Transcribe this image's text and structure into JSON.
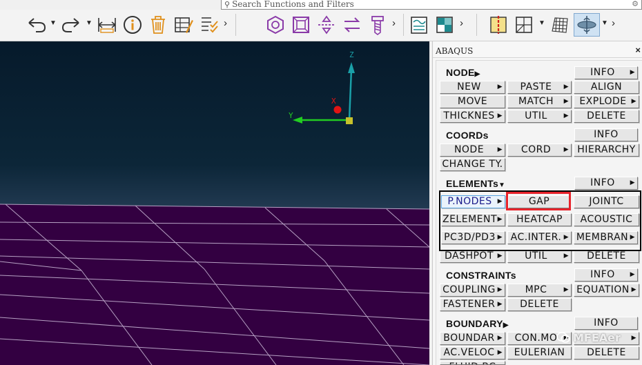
{
  "search": {
    "placeholder": "Search Functions and Filters"
  },
  "toolbar": {
    "icons": [
      "undo-icon",
      "redo-icon",
      "measure-icon",
      "info-icon",
      "delete-icon",
      "edit-property-icon",
      "checklist-icon",
      "hexagon-icon",
      "frame-icon",
      "mirror-icon",
      "swap-icon",
      "screw-icon",
      "chart-icon",
      "shading-icon",
      "section-cut-icon",
      "mesh-grid-icon",
      "wire-mesh-icon",
      "view-orient-icon"
    ]
  },
  "viewport": {
    "axis_labels": {
      "z": "Z",
      "y": "Y",
      "x": "X"
    },
    "colors": {
      "ground": "#330041",
      "grid_lines": "#b7a2c4",
      "y_axis": "#22cc22",
      "z_axis": "#1aa0a8",
      "x_marker": "#e01414",
      "origin": "#c7c12b"
    }
  },
  "panel": {
    "title": "ABAQUS",
    "close": "×",
    "sections": {
      "node": {
        "label": "NODE",
        "buttons": {
          "info": "INFO",
          "new": "NEW",
          "paste": "PASTE",
          "align": "ALIGN",
          "move": "MOVE",
          "match": "MATCH",
          "explode": "EXPLODE",
          "thickness": "THICKNES",
          "util": "UTIL",
          "delete": "DELETE"
        }
      },
      "coords": {
        "label": "COORDs",
        "buttons": {
          "info": "INFO",
          "node": "NODE",
          "cord": "CORD",
          "hierarchy": "HIERARCHY",
          "change_type": "CHANGE TY."
        }
      },
      "elements": {
        "label": "ELEMENTs",
        "buttons": {
          "info": "INFO",
          "pnodes": "P.NODES",
          "gap": "GAP",
          "jointc": "JOINTC",
          "zelement": "ZELEMENT",
          "heatcap": "HEATCAP",
          "acoustic": "ACOUSTIC",
          "pc3d": "PC3D/PD3",
          "ac_inter": "AC.INTER.",
          "membrane": "MEMBRAN",
          "dashpot": "DASHPOT",
          "util": "UTIL",
          "delete": "DELETE"
        }
      },
      "constraints": {
        "label": "CONSTRAINTs",
        "buttons": {
          "info": "INFO",
          "coupling": "COUPLING",
          "mpc": "MPC",
          "equation": "EQUATION",
          "fastener": "FASTENER",
          "delete": "DELETE"
        }
      },
      "boundary": {
        "label": "BOUNDARY",
        "buttons": {
          "info": "INFO",
          "boundary": "BOUNDAR",
          "con_mo": "CON.MO",
          "ac_veloc": "AC.VELOC",
          "eulerian": "EULERIAN",
          "delete": "DELETE",
          "fluid_bc": "FLUID BC"
        }
      }
    }
  },
  "watermark": {
    "text": "MFEAer"
  },
  "colors": {
    "highlight": "#e8232b",
    "group_border": "#000000",
    "selected_border": "#57a3e0"
  }
}
